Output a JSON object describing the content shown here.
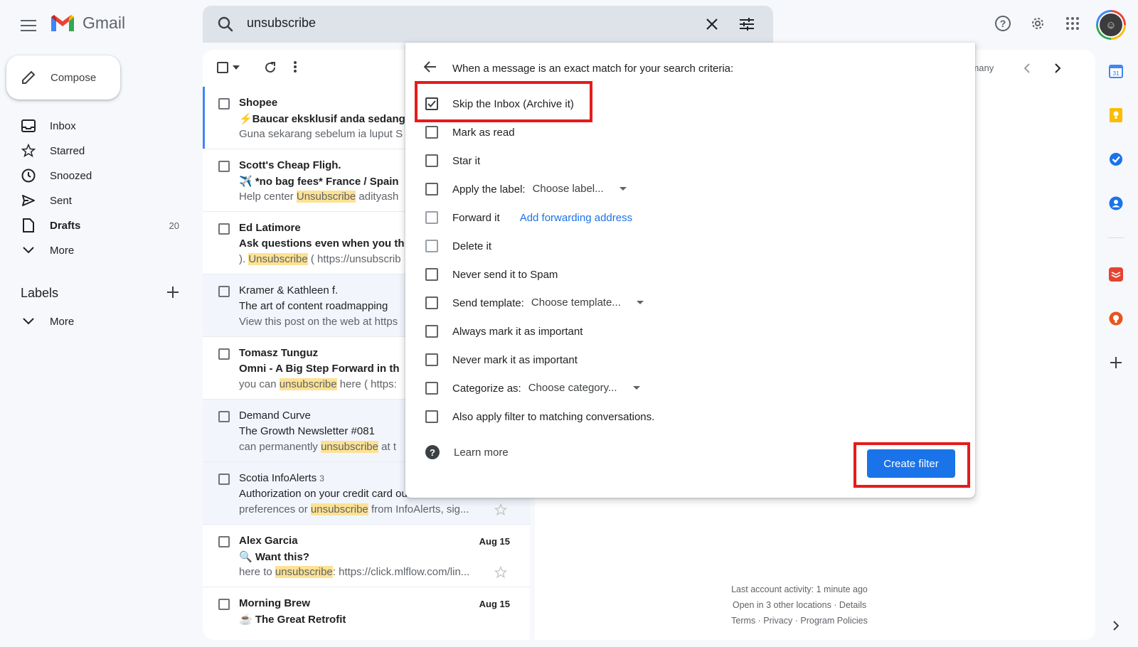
{
  "app": {
    "name": "Gmail"
  },
  "search": {
    "query": "unsubscribe"
  },
  "compose": {
    "label": "Compose"
  },
  "nav": [
    {
      "label": "Inbox",
      "icon": "inbox-icon",
      "count": ""
    },
    {
      "label": "Starred",
      "icon": "star-icon",
      "count": ""
    },
    {
      "label": "Snoozed",
      "icon": "clock-icon",
      "count": ""
    },
    {
      "label": "Sent",
      "icon": "send-icon",
      "count": ""
    },
    {
      "label": "Drafts",
      "icon": "draft-icon",
      "count": "20"
    },
    {
      "label": "More",
      "icon": "chevron-down-icon",
      "count": ""
    }
  ],
  "labels": {
    "title": "Labels",
    "more": "More"
  },
  "pager": {
    "text": "of many"
  },
  "emails": [
    {
      "sender": "Shopee",
      "count": "",
      "subject": "⚡Baucar eksklusif anda sedang",
      "snippet_pre": "Guna sekarang sebelum ia luput S",
      "snippet_hl": "",
      "snippet_post": "",
      "date": ""
    },
    {
      "sender": "Scott's Cheap Fligh.",
      "count": "",
      "subject": "✈️ *no bag fees* France / Spain",
      "snippet_pre": "Help center ",
      "snippet_hl": "Unsubscribe",
      "snippet_post": " adityash",
      "date": ""
    },
    {
      "sender": "Ed Latimore",
      "count": "",
      "subject": "Ask questions even when you th",
      "snippet_pre": "). ",
      "snippet_hl": "Unsubscribe",
      "snippet_post": " ( https://unsubscrib",
      "date": ""
    },
    {
      "sender": "Kramer & Kathleen f.",
      "count": "",
      "subject": "The art of content roadmapping",
      "snippet_pre": "View this post on the web at https",
      "snippet_hl": "",
      "snippet_post": "",
      "date": ""
    },
    {
      "sender": "Tomasz Tunguz",
      "count": "",
      "subject": "Omni - A Big Step Forward in th",
      "snippet_pre": "you can ",
      "snippet_hl": "unsubscribe",
      "snippet_post": " here ( https:",
      "date": ""
    },
    {
      "sender": "Demand Curve",
      "count": "",
      "subject": "The Growth Newsletter #081",
      "snippet_pre": "can permanently ",
      "snippet_hl": "unsubscribe",
      "snippet_post": " at t",
      "date": ""
    },
    {
      "sender": "Scotia InfoAlerts",
      "count": "3",
      "subject": "Authorization on your credit card outside of Ca...",
      "snippet_pre": "preferences or ",
      "snippet_hl": "unsubscribe",
      "snippet_post": " from InfoAlerts, sig...",
      "date": ""
    },
    {
      "sender": "Alex Garcia",
      "count": "",
      "subject": "🔍 Want this?",
      "snippet_pre": "here to ",
      "snippet_hl": "unsubscribe",
      "snippet_post": ": https://click.mlflow.com/lin...",
      "date": "Aug 15"
    },
    {
      "sender": "Morning Brew",
      "count": "",
      "subject": "☕ The Great Retrofit",
      "snippet_pre": "",
      "snippet_hl": "",
      "snippet_post": "",
      "date": "Aug 15"
    }
  ],
  "dialog": {
    "title": "When a message is an exact match for your search criteria:",
    "options": [
      {
        "label": "Skip the Inbox (Archive it)",
        "checked": true
      },
      {
        "label": "Mark as read",
        "checked": false
      },
      {
        "label": "Star it",
        "checked": false
      },
      {
        "label": "Apply the label:",
        "select": "Choose label...",
        "checked": false
      },
      {
        "label": "Forward it",
        "link": "Add forwarding address",
        "checked": false
      },
      {
        "label": "Delete it",
        "checked": false
      },
      {
        "label": "Never send it to Spam",
        "checked": false
      },
      {
        "label": "Send template:",
        "select": "Choose template...",
        "checked": false
      },
      {
        "label": "Always mark it as important",
        "checked": false
      },
      {
        "label": "Never mark it as important",
        "checked": false
      },
      {
        "label": "Categorize as:",
        "select": "Choose category...",
        "checked": false
      },
      {
        "label": "Also apply filter to matching conversations.",
        "checked": false
      }
    ],
    "learn_more": "Learn more",
    "create_button": "Create filter"
  },
  "footer": {
    "line1": "Last account activity: 1 minute ago",
    "line2": "Open in 3 other locations · Details",
    "line3": "Terms · Privacy · Program Policies"
  },
  "colors": {
    "accent": "#1a73e8",
    "highlight_box": "#e61b1b",
    "search_hl": "#fde293"
  }
}
